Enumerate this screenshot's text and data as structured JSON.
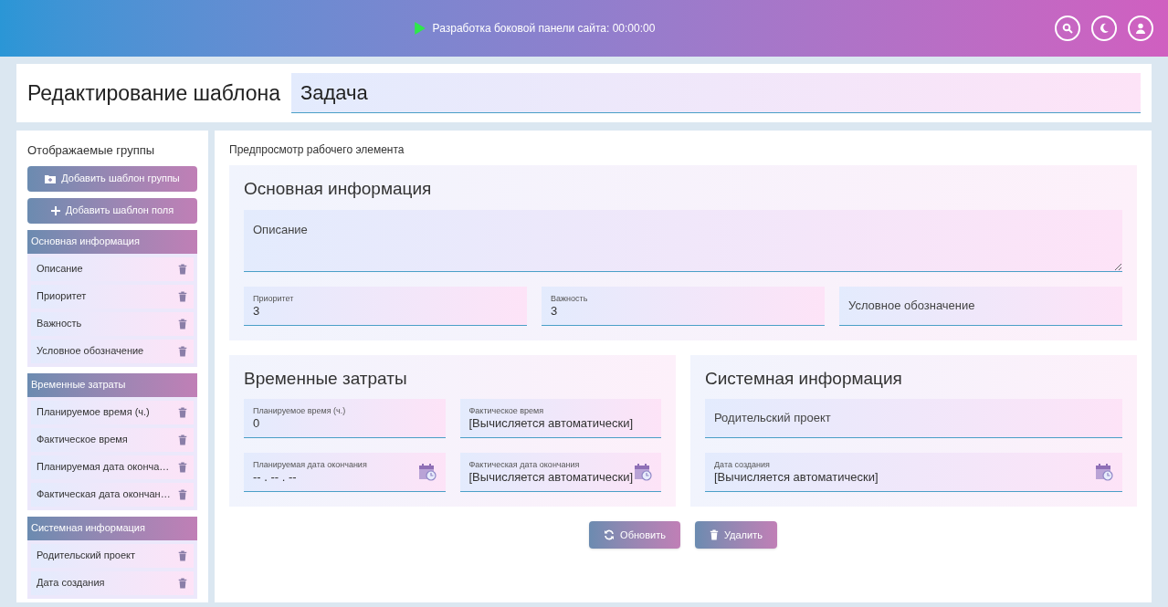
{
  "header": {
    "timer": "Разработка боковой панели сайта: 00:00:00"
  },
  "title": {
    "label": "Редактирование шаблона",
    "value": "Задача"
  },
  "sidebar": {
    "title": "Отображаемые группы",
    "buttons": [
      {
        "kind": "folder",
        "label": "Добавить шаблон группы"
      },
      {
        "kind": "plus",
        "label": "Добавить шаблон поля"
      }
    ],
    "groups": [
      {
        "name": "Основная информация",
        "items": [
          "Описание",
          "Приоритет",
          "Важность",
          "Условное обозначение"
        ]
      },
      {
        "name": "Временные затраты",
        "items": [
          "Планируемое время (ч.)",
          "Фактическое время",
          "Планируемая дата оконча…",
          "Фактическая дата окончан…"
        ]
      },
      {
        "name": "Системная информация",
        "items": [
          "Родительский проект",
          "Дата создания"
        ]
      }
    ]
  },
  "preview": {
    "title": "Предпросмотр рабочего элемента",
    "main_group": {
      "name": "Основная информация",
      "fields": [
        {
          "kind": "textarea",
          "placeholder": "Описание"
        },
        {
          "kind": "text",
          "label": "Приоритет",
          "value": "3"
        },
        {
          "kind": "text",
          "label": "Важность",
          "value": "3"
        },
        {
          "kind": "text",
          "placeholder": "Условное обозначение"
        }
      ]
    },
    "side_groups": [
      {
        "name": "Временные затраты",
        "fields": [
          {
            "kind": "text",
            "label": "Планируемое время (ч.)",
            "value": "0"
          },
          {
            "kind": "text",
            "label": "Фактическое время",
            "value": "[Вычисляется автоматически]"
          },
          {
            "kind": "date",
            "label": "Планируемая дата окончания",
            "value": "-- . -- . --"
          },
          {
            "kind": "date",
            "label": "Фактическая дата окончания",
            "value": "[Вычисляется автоматически]"
          }
        ]
      },
      {
        "name": "Системная информация",
        "fields": [
          {
            "kind": "text",
            "placeholder": "Родительский проект"
          },
          {
            "kind": "date",
            "label": "Дата создания",
            "value": "[Вычисляется автоматически]"
          }
        ]
      }
    ],
    "actions": [
      {
        "kind": "refresh",
        "label": "Обновить"
      },
      {
        "kind": "delete",
        "label": "Удалить"
      }
    ]
  }
}
